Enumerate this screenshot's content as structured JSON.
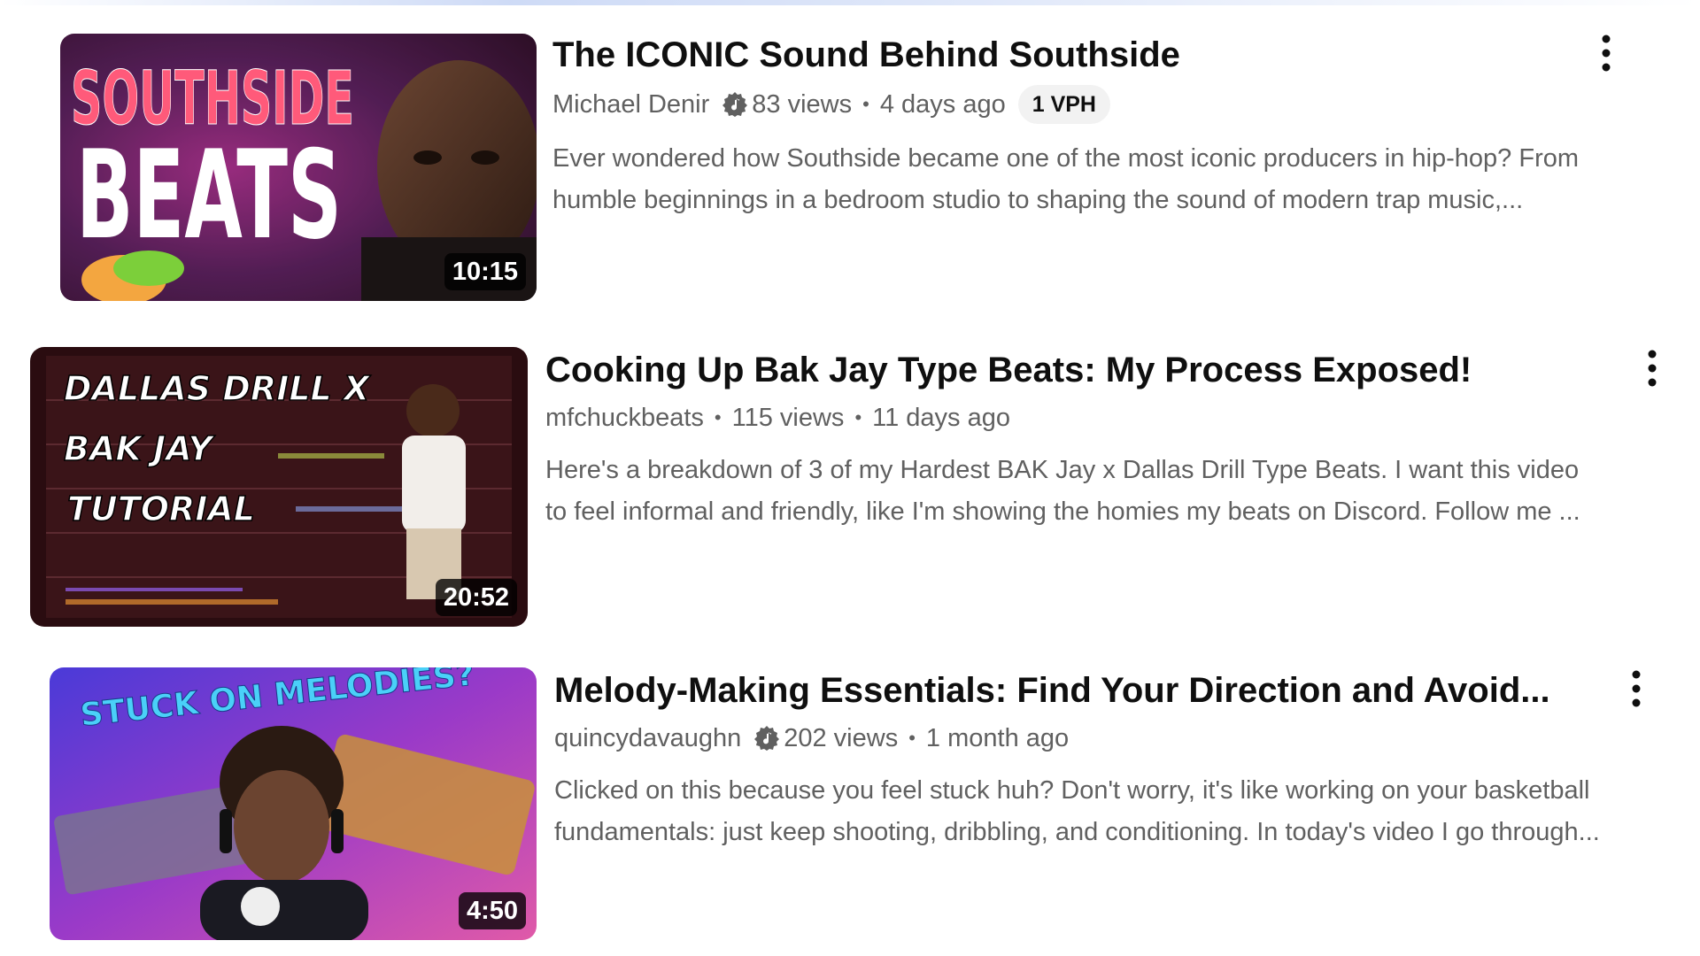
{
  "results": [
    {
      "title": "The ICONIC Sound Behind Southside",
      "channel": "Michael Denir",
      "channel_verified_icon": "music-note-verified-icon",
      "views": "83 views",
      "age": "4 days ago",
      "badge": "1 VPH",
      "duration": "10:15",
      "thumbnail_text": [
        "SOUTHSIDE",
        "BEATS"
      ],
      "description_lines": [
        "Ever wondered how Southside became one of the most iconic producers in hip-hop? From",
        "humble beginnings in a bedroom studio to shaping the sound of modern trap music,..."
      ]
    },
    {
      "title": "Cooking Up Bak Jay Type Beats: My Process Exposed!",
      "channel": "mfchuckbeats",
      "views": "115 views",
      "age": "11 days ago",
      "duration": "20:52",
      "thumbnail_text": [
        "DALLAS DRILL X",
        "BAK JAY",
        "TUTORIAL"
      ],
      "description_lines": [
        "Here's a breakdown of 3 of my Hardest BAK Jay x Dallas Drill Type Beats. I want this video",
        "to feel informal and friendly, like I'm showing the homies my beats on Discord. Follow me ..."
      ]
    },
    {
      "title": "Melody-Making Essentials: Find Your Direction and Avoid...",
      "channel": "quincydavaughn",
      "channel_verified_icon": "music-note-verified-icon",
      "views": "202 views",
      "age": "1 month ago",
      "duration": "4:50",
      "thumbnail_text": [
        "STUCK ON MELODIES?"
      ],
      "description_lines": [
        "Clicked on this because you feel stuck huh? Don't worry, it's like working on your basketball",
        "fundamentals: just keep shooting, dribbling, and conditioning. In today's video I go through..."
      ]
    }
  ],
  "separator": "•",
  "more_icon": "more-vert-icon",
  "colors": {
    "title": "#0f0f0f",
    "meta": "#606060",
    "badge_bg": "#f2f2f2",
    "duration_bg": "#000000"
  }
}
